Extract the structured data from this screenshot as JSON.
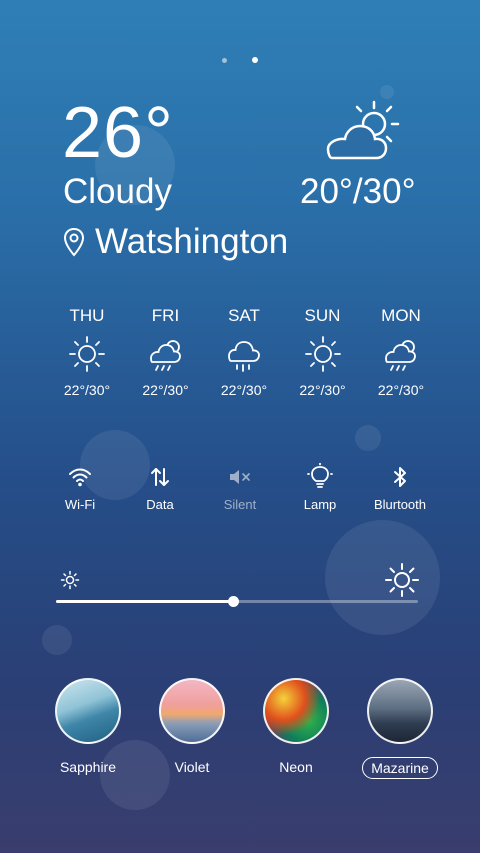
{
  "pager": {
    "pages": 2,
    "active": 2
  },
  "current": {
    "temperature": "26°",
    "condition": "Cloudy",
    "location": "Watshington",
    "range": "20°/30°",
    "icon": "partly-cloudy-icon"
  },
  "forecast": [
    {
      "day": "THU",
      "icon": "sun-icon",
      "temps": "22°/30°"
    },
    {
      "day": "FRI",
      "icon": "rain-cloud-sun-icon",
      "temps": "22°/30°"
    },
    {
      "day": "SAT",
      "icon": "rain-cloud-icon",
      "temps": "22°/30°"
    },
    {
      "day": "SUN",
      "icon": "sun-icon",
      "temps": "22°/30°"
    },
    {
      "day": "MON",
      "icon": "rain-cloud-sun-icon",
      "temps": "22°/30°"
    }
  ],
  "toggles": [
    {
      "label": "Wi-Fi",
      "icon": "wifi-icon"
    },
    {
      "label": "Data",
      "icon": "data-arrows-icon"
    },
    {
      "label": "Silent",
      "icon": "mute-icon"
    },
    {
      "label": "Lamp",
      "icon": "lamp-icon"
    },
    {
      "label": "Blurtooth",
      "icon": "bluetooth-icon"
    }
  ],
  "brightness": {
    "level": 0.49
  },
  "themes": [
    {
      "name": "Sapphire",
      "selected": false
    },
    {
      "name": "Violet",
      "selected": false
    },
    {
      "name": "Neon",
      "selected": false
    },
    {
      "name": "Mazarine",
      "selected": true
    }
  ]
}
